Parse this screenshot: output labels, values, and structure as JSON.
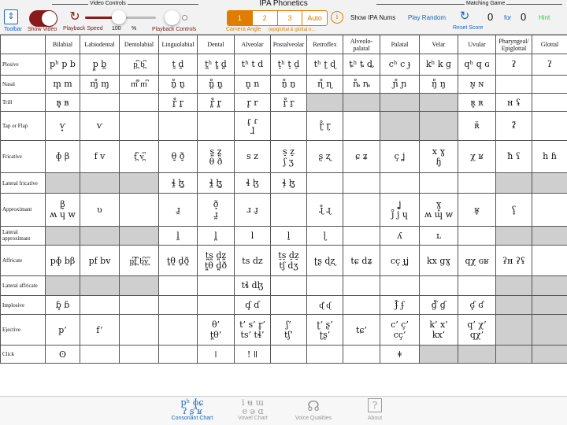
{
  "app": {
    "title": "IPA Phonetics"
  },
  "toolbar": {
    "video_controls_label": "Video  Controls",
    "matching_game_label": "Matching Game",
    "toolbar_label": "Toolbar",
    "toolbar_icon": "arrows-updown-icon",
    "show_video_label": "Show Video",
    "show_video_on": true,
    "playback_speed_label": "Playback Speed",
    "speed_value": "100",
    "speed_unit": "%",
    "speed_fraction": 0.48,
    "playback_controls_label": "Playback Controls",
    "camera_angle_label": "Camera Angle",
    "angle_options": [
      "1",
      "2",
      "3",
      "Auto"
    ],
    "angle_selected": "1",
    "angle_note": "(epiglottal & glottal o...",
    "info_icon": "i",
    "show_ipa_nums_label": "Show IPA Nums",
    "play_random_label": "Play Random",
    "reset_score_label": "Reset Score",
    "score": "0",
    "for_label": "for",
    "score_total": "0",
    "hint_label": "Hint",
    "accent": "#e07c00",
    "brand_red": "#8b1a1a",
    "link_blue": "#1565c0",
    "hint_green": "#2ecc40"
  },
  "table": {
    "columns": [
      "Bilabial",
      "Labiodental",
      "Dentolabial",
      "Linguolabial",
      "Dental",
      "Alveolar",
      "Postalveolar",
      "Retroflex",
      "Alveolo-palatal",
      "Palatal",
      "Velar",
      "Uvular",
      "Pharyngeal/ Epiglottal",
      "Glottal"
    ],
    "rows": [
      {
        "label": "Plosive",
        "cells": [
          [
            "pʰ p b"
          ],
          [
            "p̪  b̪"
          ],
          [
            "p̪͆  b̪͆"
          ],
          [
            "t̼  d̼"
          ],
          [
            "t̪ʰ t̪  d̪"
          ],
          [
            "tʰ t  d"
          ],
          [
            "t̠ʰ t̠  d̠"
          ],
          [
            "tʰ ʈ  ɖ"
          ],
          [
            "ȶʰ ȶ  ȡ"
          ],
          [
            "cʰ  c  ɟ"
          ],
          [
            "kʰ k  ɡ"
          ],
          [
            "qʰ q  ɢ"
          ],
          [
            "ʡ",
            ""
          ],
          [
            "ʔ",
            ""
          ]
        ]
      },
      {
        "label": "Nasal",
        "cells": [
          [
            "m̥  m"
          ],
          [
            "ɱ̊  ɱ"
          ],
          [
            "m͆̊  m͆"
          ],
          [
            "n̼̊  n̼"
          ],
          [
            "n̪̊  n̪"
          ],
          [
            "n̥  n"
          ],
          [
            "n̠̊  n̠"
          ],
          [
            "ɳ̊  ɳ"
          ],
          [
            "ȵ̊  ȵ"
          ],
          [
            "ɲ̊  ɲ"
          ],
          [
            "ŋ̊  ŋ"
          ],
          [
            "ɴ̥  ɴ"
          ],
          [
            ""
          ],
          [
            ""
          ]
        ]
      },
      {
        "label": "Trill",
        "cells": [
          [
            "ʙ̥  ʙ"
          ],
          [
            ""
          ],
          [
            ""
          ],
          [
            "r̼̊  r̼"
          ],
          [
            "r̪̊  r̪"
          ],
          [
            "r̥  r"
          ],
          [
            "r̠̊  r̠"
          ],
          [
            ""
          ],
          [
            ""
          ],
          [
            ""
          ],
          [
            ""
          ],
          [
            "ʀ̥  ʀ"
          ],
          [
            "ʜ  ʢ"
          ],
          [
            ""
          ]
        ]
      },
      {
        "label": "Tap or Flap",
        "cells": [
          [
            "ⱱ̟"
          ],
          [
            "ⱱ"
          ],
          [
            ""
          ],
          [
            ""
          ],
          [
            ""
          ],
          [
            "ɾ̥  ɾ",
            "ɺ"
          ],
          [
            ""
          ],
          [
            "ɽ̊  ɽ"
          ],
          [
            ""
          ],
          [
            ""
          ],
          [
            ""
          ],
          [
            "ʀ̆"
          ],
          [
            "ʡ̆"
          ],
          [
            ""
          ]
        ]
      },
      {
        "label": "Fricative",
        "cells": [
          [
            "ɸ  β"
          ],
          [
            "f  v"
          ],
          [
            "f̪͆  v̪͆"
          ],
          [
            "",
            "θ̼  ð̼"
          ],
          [
            "s̪  z̪",
            "θ  ð"
          ],
          [
            "s  z"
          ],
          [
            "s̠  z̠",
            "ʃ  ʒ"
          ],
          [
            "ʂ  ʐ"
          ],
          [
            "ɕ  ʑ"
          ],
          [
            "ç  ʝ"
          ],
          [
            "x  ɣ",
            "ɧ"
          ],
          [
            "χ  ʁ"
          ],
          [
            "ħ  ʕ"
          ],
          [
            "h  ɦ"
          ]
        ]
      },
      {
        "label": "Lateral fricative",
        "cells": [
          [
            ""
          ],
          [
            ""
          ],
          [
            ""
          ],
          [
            "ɬ̼  ɮ̼"
          ],
          [
            "ɬ̪  ɮ̪"
          ],
          [
            "ɬ  ɮ"
          ],
          [
            "ɬ̠  ɮ̠"
          ],
          [
            ""
          ],
          [
            ""
          ],
          [
            ""
          ],
          [
            ""
          ],
          [
            ""
          ],
          [
            ""
          ],
          [
            ""
          ]
        ]
      },
      {
        "label": "Approximant",
        "cells": [
          [
            "β̞",
            "ʍ  ɥ w"
          ],
          [
            "ʋ"
          ],
          [
            ""
          ],
          [
            "",
            "ɹ̼"
          ],
          [
            "ð̞",
            "ɹ̪"
          ],
          [
            "",
            "ɹ  ɹ̠"
          ],
          [
            ""
          ],
          [
            "",
            "ɻ̊  ɻ"
          ],
          [
            ""
          ],
          [
            "ʝ̞",
            "j̊  j ɥ"
          ],
          [
            "ɣ̞",
            "ʍ  ɰ w"
          ],
          [
            "ʁ̞"
          ],
          [
            "ʕ̞"
          ],
          [
            ""
          ]
        ]
      },
      {
        "label": "Lateral approximant",
        "cells": [
          [
            ""
          ],
          [
            ""
          ],
          [
            ""
          ],
          [
            "l̼"
          ],
          [
            "l̪"
          ],
          [
            "l"
          ],
          [
            "l̠"
          ],
          [
            "ɭ"
          ],
          [
            ""
          ],
          [
            "ʎ"
          ],
          [
            "ʟ"
          ],
          [
            ""
          ],
          [
            ""
          ],
          [
            ""
          ]
        ]
      },
      {
        "label": "Affricate",
        "cells": [
          [
            "pɸ bβ"
          ],
          [
            "pf  bv"
          ],
          [
            "p̪͆f̪͆  b̪͆v̪͆"
          ],
          [
            "",
            "t̼θ̼  d̼ð̼"
          ],
          [
            "t̪s̪  d̪z̪",
            "t̪θ  d̪ð"
          ],
          [
            "ts  dz"
          ],
          [
            "t̠s̠  d̠z̠",
            "tʃ  dʒ"
          ],
          [
            "ʈʂ  ɖʐ"
          ],
          [
            "tɕ  dʑ"
          ],
          [
            "cç  ɟʝ"
          ],
          [
            "kx  ɡɣ"
          ],
          [
            "qχ  ɢʁ"
          ],
          [
            "ʡʜ  ʡʢ"
          ],
          [
            ""
          ]
        ]
      },
      {
        "label": "Lateral affricate",
        "cells": [
          [
            ""
          ],
          [
            ""
          ],
          [
            ""
          ],
          [
            ""
          ],
          [
            ""
          ],
          [
            "tɬ  dɮ"
          ],
          [
            ""
          ],
          [
            ""
          ],
          [
            ""
          ],
          [
            ""
          ],
          [
            ""
          ],
          [
            ""
          ],
          [
            ""
          ],
          [
            ""
          ]
        ]
      },
      {
        "label": "Implosive",
        "cells": [
          [
            "ɓ̥  ɓ"
          ],
          [
            ""
          ],
          [
            ""
          ],
          [
            ""
          ],
          [
            ""
          ],
          [
            "ɗ̥  ɗ"
          ],
          [
            ""
          ],
          [
            "ᶑ̊  ᶑ"
          ],
          [
            ""
          ],
          [
            "ʄ̊  ʄ"
          ],
          [
            "ɠ̊  ɠ"
          ],
          [
            "ʛ̥  ʛ"
          ],
          [
            ""
          ],
          [
            ""
          ]
        ]
      },
      {
        "label": "Ejective",
        "cells": [
          [
            "p’"
          ],
          [
            "f’"
          ],
          [
            ""
          ],
          [
            ""
          ],
          [
            "θ’",
            "t̪θ’"
          ],
          [
            "t’ s’ r̥’",
            "ts’ tɬ’"
          ],
          [
            "ʃ’",
            "tʃ’"
          ],
          [
            "ʈ’ ʂ’",
            "ʈʂ’"
          ],
          [
            "tɕ’"
          ],
          [
            "c’ ç’",
            "cç’"
          ],
          [
            "k’ x’",
            "kx’"
          ],
          [
            "q’ χ’",
            "qχ’"
          ],
          [
            ""
          ],
          [
            ""
          ]
        ]
      },
      {
        "label": "Click",
        "cells": [
          [
            "ʘ"
          ],
          [
            ""
          ],
          [
            ""
          ],
          [
            ""
          ],
          [
            "ǀ"
          ],
          [
            "!  ǁ"
          ],
          [
            ""
          ],
          [
            ""
          ],
          [
            ""
          ],
          [
            "ǂ"
          ],
          [
            ""
          ],
          [
            ""
          ],
          [
            ""
          ],
          [
            ""
          ]
        ]
      }
    ]
  },
  "tabs": [
    {
      "label": "Consonant Chart",
      "glyph1": "pʰ ɸ̪ɕ",
      "glyph2": "ʔ ʂ ʁ",
      "icon": "consonant-chart-icon",
      "active": true
    },
    {
      "label": "Vowel Chart",
      "glyph1": "i ʉ ɯ",
      "glyph2": "e ə ɑ",
      "icon": "vowel-chart-icon",
      "active": false
    },
    {
      "label": "Voice Qualities",
      "glyph1": "☊",
      "glyph2": "",
      "icon": "voice-qualities-icon",
      "active": false
    },
    {
      "label": "About",
      "glyph1": "?",
      "glyph2": "",
      "icon": "about-icon",
      "active": false
    }
  ]
}
